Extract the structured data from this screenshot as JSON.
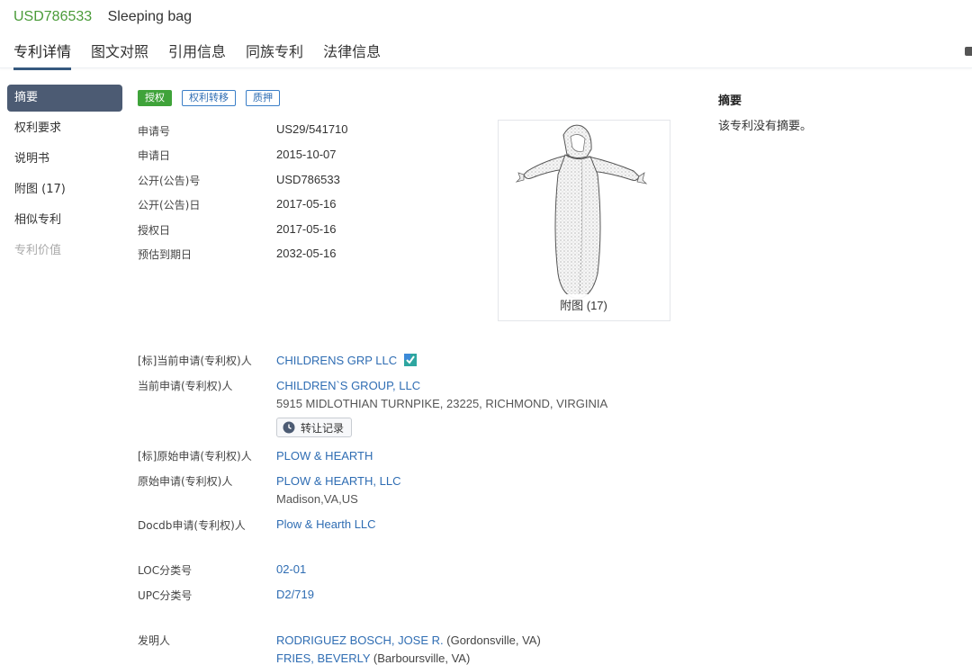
{
  "header": {
    "pub_no": "USD786533",
    "title": "Sleeping bag",
    "tabs": [
      "专利详情",
      "图文对照",
      "引用信息",
      "同族专利",
      "法律信息"
    ]
  },
  "sidebar": {
    "items": [
      {
        "label": "摘要"
      },
      {
        "label": "权利要求"
      },
      {
        "label": "说明书"
      },
      {
        "label": "附图 (17)"
      },
      {
        "label": "相似专利"
      },
      {
        "label": "专利价值"
      }
    ]
  },
  "tags": [
    "授权",
    "权利转移",
    "质押"
  ],
  "basic": [
    {
      "label": "申请号",
      "value": "US29/541710"
    },
    {
      "label": "申请日",
      "value": "2015-10-07"
    },
    {
      "label": "公开(公告)号",
      "value": "USD786533"
    },
    {
      "label": "公开(公告)日",
      "value": "2017-05-16"
    },
    {
      "label": "授权日",
      "value": "2017-05-16"
    },
    {
      "label": "预估到期日",
      "value": "2032-05-16"
    }
  ],
  "figure": {
    "caption": "附图 (17)"
  },
  "abstract": {
    "title": "摘要",
    "text": "该专利没有摘要。"
  },
  "parties": {
    "std_current_label": "[标]当前申请(专利权)人",
    "std_current_value": "CHILDRENS GRP LLC",
    "current_label": "当前申请(专利权)人",
    "current_value": "CHILDREN`S GROUP, LLC",
    "current_address": "5915 MIDLOTHIAN TURNPIKE, 23225, RICHMOND, VIRGINIA",
    "transfer_button": "转让记录",
    "std_original_label": "[标]原始申请(专利权)人",
    "std_original_value": "PLOW & HEARTH",
    "original_label": "原始申请(专利权)人",
    "original_value": "PLOW & HEARTH, LLC",
    "original_location": "Madison,VA,US",
    "docdb_label": "Docdb申请(专利权)人",
    "docdb_value": "Plow & Hearth LLC"
  },
  "classification": {
    "loc_label": "LOC分类号",
    "loc_value": "02-01",
    "upc_label": "UPC分类号",
    "upc_value": "D2/719"
  },
  "inventors": {
    "label": "发明人",
    "list": [
      {
        "name": "RODRIGUEZ BOSCH, JOSE R.",
        "location": "(Gordonsville, VA)"
      },
      {
        "name": "FRIES, BEVERLY",
        "location": "(Barboursville, VA)"
      }
    ]
  },
  "colors": {
    "accent": "#36597f",
    "link": "#2f6db3",
    "granted": "#3fa33a",
    "pub_no": "#4a9b39"
  }
}
